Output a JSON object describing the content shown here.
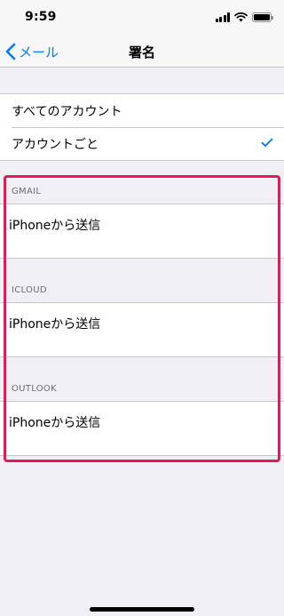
{
  "status": {
    "time": "9:59"
  },
  "nav": {
    "back_label": "メール",
    "title": "署名"
  },
  "account_options": [
    {
      "label": "すべてのアカウント",
      "selected": false
    },
    {
      "label": "アカウントごと",
      "selected": true
    }
  ],
  "signatures": [
    {
      "account": "GMAIL",
      "text": "iPhoneから送信"
    },
    {
      "account": "ICLOUD",
      "text": "iPhoneから送信"
    },
    {
      "account": "OUTLOOK",
      "text": "iPhoneから送信"
    }
  ],
  "colors": {
    "accent": "#007aff",
    "highlight": "#e8175d",
    "background": "#efeff4"
  },
  "icons": [
    "signal-icon",
    "wifi-icon",
    "battery-icon",
    "chevron-left-icon",
    "checkmark-icon"
  ]
}
